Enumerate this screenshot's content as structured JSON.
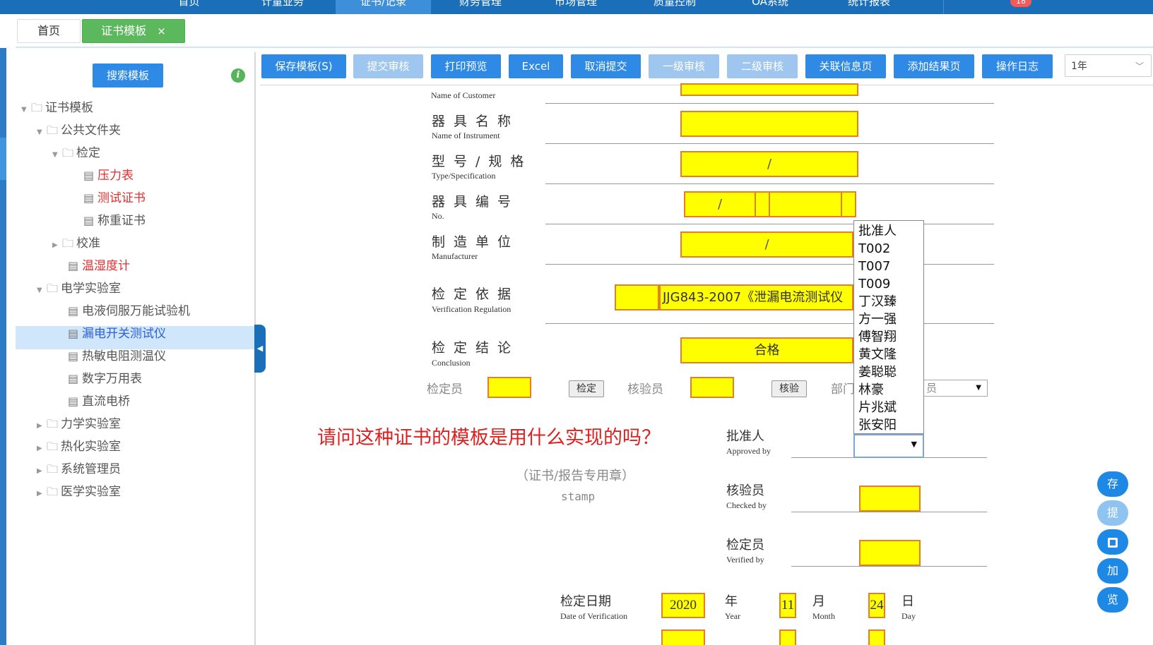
{
  "nav": {
    "items": [
      "首页",
      "计量业务",
      "证书/记录",
      "财务管理",
      "市场管理",
      "质量控制",
      "OA系统",
      "统计报表"
    ],
    "badge": "18"
  },
  "tabs": {
    "home": "首页",
    "cert": "证书模板",
    "close": "×"
  },
  "sidebar": {
    "search": "搜索模板",
    "info": "i",
    "tree": {
      "root": "证书模板",
      "public": "公共文件夹",
      "verify": "检定",
      "pressure": "压力表",
      "test_cert": "测试证书",
      "weigh_cert": "称重证书",
      "calib": "校准",
      "hygro": "温湿度计",
      "elec_lab": "电学实验室",
      "servo": "电液伺服万能试验机",
      "leak": "漏电开关测试仪",
      "thermistor": "热敏电阻测温仪",
      "multimeter": "数字万用表",
      "dc_bridge": "直流电桥",
      "mech_lab": "力学实验室",
      "thermo_lab": "热化实验室",
      "sys_admin": "系统管理员",
      "med_lab": "医学实验室"
    }
  },
  "toolbar": {
    "save": "保存模板(S)",
    "submit": "提交审核",
    "print": "打印预览",
    "excel": "Excel",
    "cancel": "取消提交",
    "review1": "一级审核",
    "review2": "二级审核",
    "related": "关联信息页",
    "add_result": "添加结果页",
    "log": "操作日志",
    "year": "1年"
  },
  "cert": {
    "customer_en": "Name of Customer",
    "instrument_cn": "器具名称",
    "instrument_en": "Name of Instrument",
    "type_cn": "型号/规格",
    "type_en": "Type/Specification",
    "type_val": "/",
    "no_cn": "器具编号",
    "no_en": "No.",
    "no_val": "/",
    "mfr_cn": "制造单位",
    "mfr_en": "Manufacturer",
    "mfr_val": "/",
    "reg_cn": "检定依据",
    "reg_en": "Verification Regulation",
    "reg_val": "JJG843-2007《泄漏电流测试仪",
    "concl_cn": "检定结论",
    "concl_en": "Conclusion",
    "concl_val": "合格",
    "verifier_label": "检定员",
    "verify_btn": "检定",
    "checker_label": "核验员",
    "check_btn": "核验",
    "dept_label": "部门",
    "dept_select": "员",
    "question": "请问这种证书的模板是用什么实现的吗？",
    "stamp_cn": "（证书/报告专用章）",
    "stamp_en": "stamp",
    "approved_cn": "批准人",
    "approved_en": "Approved by",
    "checked_cn": "核验员",
    "checked_en": "Checked by",
    "verified_cn": "检定员",
    "verified_en": "Verified by",
    "date_cn": "检定日期",
    "date_en": "Date of Verification",
    "year_val": "2020",
    "year_cn": "年",
    "year_en": "Year",
    "month_val": "11",
    "month_cn": "月",
    "month_en": "Month",
    "day_val": "24",
    "day_cn": "日",
    "day_en": "Day"
  },
  "dropdown": {
    "options": [
      "批准人",
      "T002",
      "T007",
      "T009",
      "丁汉臻",
      "方一强",
      "傅智翔",
      "黄文隆",
      "姜聪聪",
      "林豪",
      "片兆斌",
      "张安阳"
    ]
  },
  "fabs": [
    "存",
    "提",
    "加",
    "览"
  ],
  "colors": {
    "nav": "#1b6fb8",
    "accent": "#2f8ae5",
    "field": "#ffff00",
    "field_border": "#e57f2a",
    "question": "#e0201f"
  }
}
